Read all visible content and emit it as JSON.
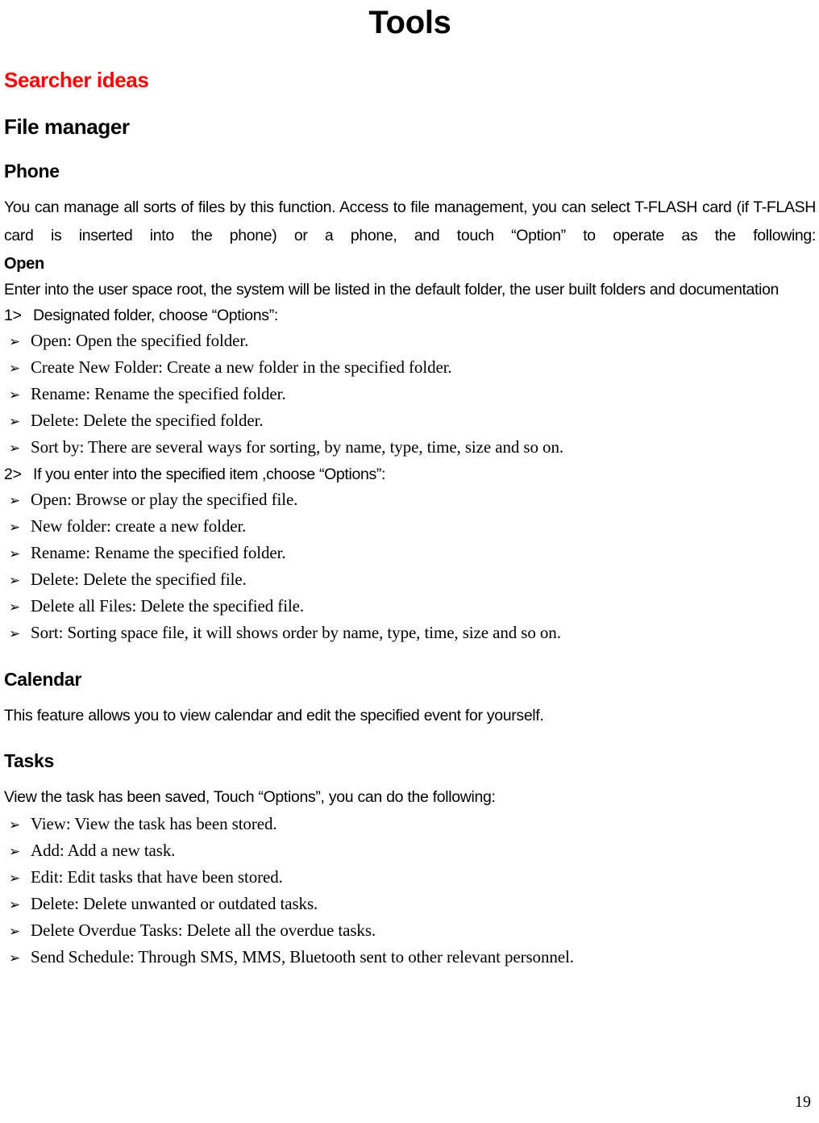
{
  "document": {
    "title": "Tools",
    "page_number": "19",
    "accent_color": "#FF0000",
    "text_color": "#000000",
    "background_color": "#FFFFFF"
  },
  "sections": {
    "searcher_ideas": {
      "heading": "Searcher ideas"
    },
    "file_manager": {
      "heading": "File manager",
      "phone": {
        "heading": "Phone",
        "intro": "You can manage all sorts of files by this function. Access to file management, you can select T-FLASH card (if T-FLASH card is inserted into the phone) or a phone, and touch “Option” to operate as the following:",
        "open_label": "Open",
        "open_body": "Enter into the user space root, the system will be listed in the default folder, the user built folders and documentation",
        "step1": {
          "number": "1>",
          "text": "Designated folder, choose “Options”:",
          "bullets": [
            "Open: Open the specified folder.",
            "Create New Folder: Create a new folder in the specified folder.",
            "Rename: Rename the specified folder.",
            "Delete: Delete the specified folder.",
            "Sort by: There are several ways for sorting, by name, type, time, size and so on."
          ]
        },
        "step2": {
          "number": "2>",
          "text": "If you enter into the specified item ,choose “Options”:",
          "bullets": [
            "Open: Browse or play the specified file.",
            "New folder: create a new folder.",
            "Rename: Rename the specified folder.",
            "Delete: Delete the specified file.",
            "Delete all Files: Delete the specified file.",
            "Sort: Sorting space file, it will shows order by name, type, time, size and so on."
          ]
        }
      }
    },
    "calendar": {
      "heading": "Calendar",
      "body": "This feature allows you to view calendar and edit the specified event for yourself."
    },
    "tasks": {
      "heading": "Tasks",
      "intro": "View the task has been saved, Touch “Options”, you can do the following:",
      "bullets": [
        "View: View the task has been stored.",
        "Add: Add a new task.",
        "Edit: Edit tasks that have been stored.",
        "Delete: Delete unwanted or outdated tasks.",
        "Delete Overdue Tasks: Delete all the overdue tasks.",
        "Send Schedule: Through SMS, MMS, Bluetooth sent to other relevant personnel."
      ]
    }
  },
  "icons": {
    "bullet_arrow": "➢"
  }
}
